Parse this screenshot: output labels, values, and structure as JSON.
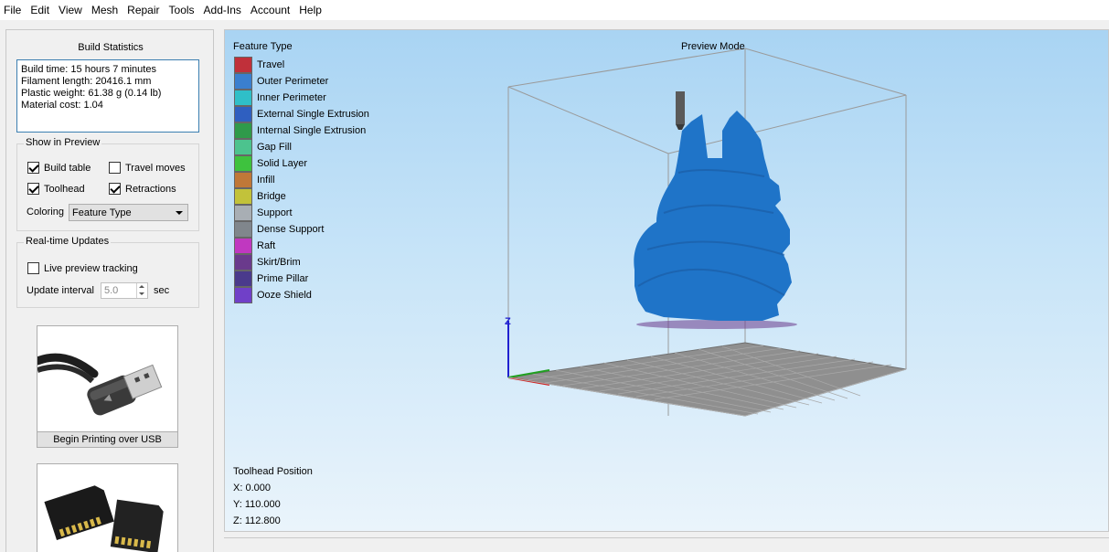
{
  "menu": [
    "File",
    "Edit",
    "View",
    "Mesh",
    "Repair",
    "Tools",
    "Add-Ins",
    "Account",
    "Help"
  ],
  "build_stats": {
    "title": "Build Statistics",
    "lines": [
      "Build time: 15 hours 7 minutes",
      "Filament length: 20416.1 mm",
      "Plastic weight: 61.38 g (0.14 lb)",
      "Material cost: 1.04"
    ]
  },
  "show_in_preview": {
    "title": "Show in Preview",
    "build_table": {
      "label": "Build table",
      "checked": true
    },
    "travel_moves": {
      "label": "Travel moves",
      "checked": false
    },
    "toolhead": {
      "label": "Toolhead",
      "checked": true
    },
    "retractions": {
      "label": "Retractions",
      "checked": true
    },
    "coloring_label": "Coloring",
    "coloring_value": "Feature Type"
  },
  "realtime_updates": {
    "title": "Real-time Updates",
    "live_preview": {
      "label": "Live preview tracking",
      "checked": false
    },
    "interval_label": "Update interval",
    "interval_value": "5.0",
    "interval_unit": "sec"
  },
  "buttons": {
    "usb_label": "Begin Printing over USB"
  },
  "preview": {
    "legend_title": "Feature Type",
    "mode_label": "Preview Mode",
    "axis_z": "Z",
    "legend": [
      {
        "label": "Travel",
        "color": "#c0303a"
      },
      {
        "label": "Outer Perimeter",
        "color": "#3a7fcf"
      },
      {
        "label": "Inner Perimeter",
        "color": "#2fbfc8"
      },
      {
        "label": "External Single Extrusion",
        "color": "#2f5fc0"
      },
      {
        "label": "Internal Single Extrusion",
        "color": "#2f9a4a"
      },
      {
        "label": "Gap Fill",
        "color": "#4cc38e"
      },
      {
        "label": "Solid Layer",
        "color": "#3ec23e"
      },
      {
        "label": "Infill",
        "color": "#c07838"
      },
      {
        "label": "Bridge",
        "color": "#c2c23a"
      },
      {
        "label": "Support",
        "color": "#a8aeb4"
      },
      {
        "label": "Dense Support",
        "color": "#80868c"
      },
      {
        "label": "Raft",
        "color": "#c038c0"
      },
      {
        "label": "Skirt/Brim",
        "color": "#6a3a8c"
      },
      {
        "label": "Prime Pillar",
        "color": "#4a3a8c"
      },
      {
        "label": "Ooze Shield",
        "color": "#7040c8"
      }
    ],
    "toolhead": {
      "title": "Toolhead Position",
      "x": "X: 0.000",
      "y": "Y: 110.000",
      "z": "Z: 112.800"
    }
  }
}
